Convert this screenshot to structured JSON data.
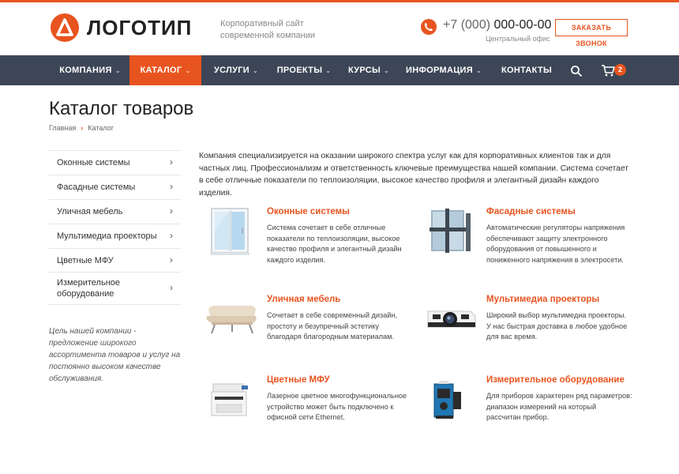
{
  "header": {
    "logo_text": "ЛОГОТИП",
    "tagline": "Корпоративный сайт современной компании",
    "phone_code": "+7 (000)",
    "phone_number": "000-00-00",
    "phone_sub": "Центральный офис",
    "callback_label": "ЗАКАЗАТЬ ЗВОНОК"
  },
  "nav": {
    "items": [
      {
        "label": "КОМПАНИЯ",
        "caret": "⌄"
      },
      {
        "label": "КАТАЛОГ",
        "caret": "⌄"
      },
      {
        "label": "УСЛУГИ",
        "caret": "⌄"
      },
      {
        "label": "ПРОЕКТЫ",
        "caret": "⌄"
      },
      {
        "label": "КУРСЫ",
        "caret": "⌄"
      },
      {
        "label": "ИНФОРМАЦИЯ",
        "caret": "⌄"
      },
      {
        "label": "КОНТАКТЫ"
      }
    ],
    "cart_count": "2"
  },
  "page": {
    "title": "Каталог товаров",
    "breadcrumb": [
      "Главная",
      "Каталог"
    ],
    "breadcrumb_sep": "›"
  },
  "sidebar": {
    "items": [
      {
        "label": "Оконные системы"
      },
      {
        "label": "Фасадные системы"
      },
      {
        "label": "Уличная мебель"
      },
      {
        "label": "Мультимедиа проекторы"
      },
      {
        "label": "Цветные МФУ"
      },
      {
        "label": "Измерительное оборудование"
      }
    ],
    "chevron": "›",
    "note": "Цель нашей компании - предложение широкого ассортимента товаров и услуг на постоянно высоком качестве обслуживания."
  },
  "intro": "Компания специализируется на оказании широкого спектра услуг как для корпоративных клиентов так и для частных лиц. Профессионализм и ответственность ключевые преимущества нашей компании. Система сочетает в себе отличные показатели по теплоизоляции, высокое качество профиля и элегантный дизайн каждого изделия.",
  "products": [
    {
      "title": "Оконные системы",
      "desc": "Система сочетает в себе отличные показатели по теплоизоляции, высокое качество профиля и элегантный дизайн каждого изделия.",
      "icon": "window-image"
    },
    {
      "title": "Фасадные системы",
      "desc": "Автоматические регуляторы напряжения обеспечивают защиту электронного оборудования от повышенного и пониженного напряжения в электросети.",
      "icon": "facade-image"
    },
    {
      "title": "Уличная мебель",
      "desc": "Сочетает в себе современный дизайн, простоту и безупречный эстетику благодаря благородным материалам.",
      "icon": "sofa-image"
    },
    {
      "title": "Мультимедиа проекторы",
      "desc": "Широкий выбор мультимедиа проекторы. У нас быстрая доставка в любое удобное для вас время.",
      "icon": "projector-image"
    },
    {
      "title": "Цветные МФУ",
      "desc": "Лазерное цветное многофункциональное устройство может быть подключено к офисной сети Ethernet.",
      "icon": "printer-image"
    },
    {
      "title": "Измерительное оборудование",
      "desc": "Для приборов характерен ряд параметров: диапазон измерений на который рассчитан прибор.",
      "icon": "laser-level-image"
    }
  ],
  "colors": {
    "accent": "#e8541f",
    "nav_bg": "#3c4656"
  }
}
